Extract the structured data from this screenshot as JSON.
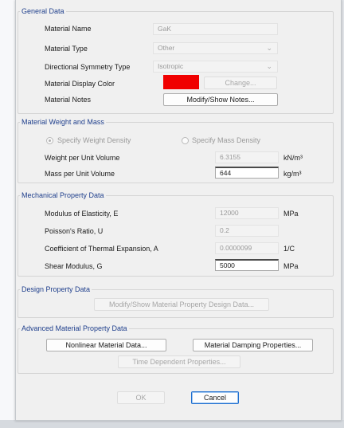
{
  "general": {
    "title": "General Data",
    "name_label": "Material Name",
    "name_value": "GaK",
    "type_label": "Material Type",
    "type_value": "Other",
    "symmetry_label": "Directional Symmetry Type",
    "symmetry_value": "Isotropic",
    "color_label": "Material Display Color",
    "display_color": "#f00000",
    "change_label": "Change...",
    "notes_label": "Material Notes",
    "notes_button": "Modify/Show Notes..."
  },
  "weight": {
    "title": "Material Weight and Mass",
    "radio_weight": "Specify Weight Density",
    "radio_mass": "Specify Mass Density",
    "weight_label": "Weight per Unit Volume",
    "weight_value": "6.3155",
    "weight_unit": "kN/m³",
    "mass_label": "Mass per Unit Volume",
    "mass_value": "644",
    "mass_unit": "kg/m³"
  },
  "mechanical": {
    "title": "Mechanical Property Data",
    "modulus_label": "Modulus of Elasticity,  E",
    "modulus_value": "12000",
    "modulus_unit": "MPa",
    "poisson_label": "Poisson's Ratio,  U",
    "poisson_value": "0.2",
    "thermal_label": "Coefficient of Thermal Expansion,  A",
    "thermal_value": "0.0000099",
    "thermal_unit": "1/C",
    "shear_label": "Shear Modulus,  G",
    "shear_value": "5000",
    "shear_unit": "MPa"
  },
  "design": {
    "title": "Design Property Data",
    "button": "Modify/Show Material Property Design Data..."
  },
  "advanced": {
    "title": "Advanced Material Property Data",
    "nonlinear_button": "Nonlinear Material Data...",
    "damping_button": "Material Damping Properties...",
    "time_button": "Time Dependent Properties..."
  },
  "footer": {
    "ok": "OK",
    "cancel": "Cancel"
  }
}
